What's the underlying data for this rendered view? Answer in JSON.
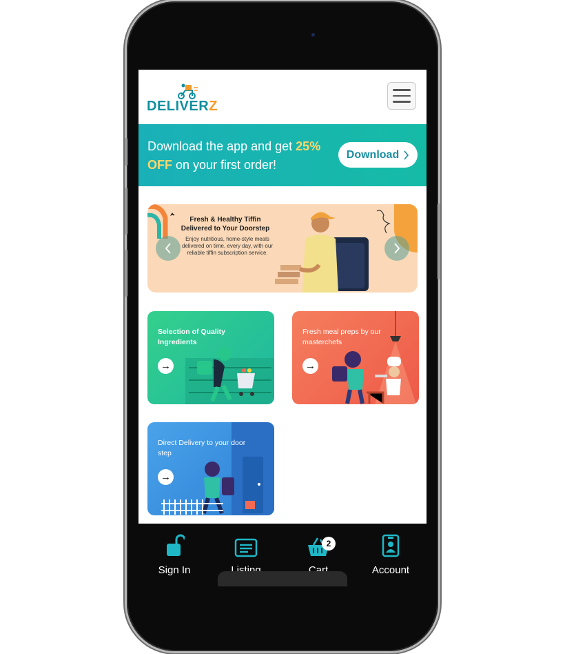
{
  "header": {
    "logo_text_main": "DELIVER",
    "logo_text_accent": "Z",
    "menu_icon": "hamburger-menu-icon"
  },
  "promo": {
    "text_before": "Download the app and get ",
    "text_highlight": "25% OFF",
    "text_after": " on your first order!",
    "button_label": "Download",
    "button_icon": "chevron-right-icon"
  },
  "hero": {
    "title": "Fresh & Healthy Tiffin Delivered to Your Doorstep",
    "description": "Enjoy nutritious, home-style meals delivered on time, every day, with our reliable tiffin subscription service.",
    "prev_icon": "chevron-left-icon",
    "next_icon": "chevron-right-icon"
  },
  "cards": [
    {
      "title": "Selection of Quality Ingredients",
      "color": "#2ec88a"
    },
    {
      "title": "Fresh meal preps by our masterchefs",
      "color": "#f26a54"
    },
    {
      "title": "Direct Delivery to your door step",
      "color": "#3c92e0"
    }
  ],
  "bottom_nav": [
    {
      "label": "Sign In",
      "icon": "unlock-icon"
    },
    {
      "label": "Listing",
      "icon": "listing-icon"
    },
    {
      "label": "Cart",
      "icon": "basket-icon",
      "badge": "2"
    },
    {
      "label": "Account",
      "icon": "account-badge-icon"
    }
  ],
  "colors": {
    "brand_teal": "#1ab0b8",
    "brand_orange": "#f39b2a",
    "promo_highlight": "#ffd66b",
    "nav_icon": "#1fb7c6"
  }
}
